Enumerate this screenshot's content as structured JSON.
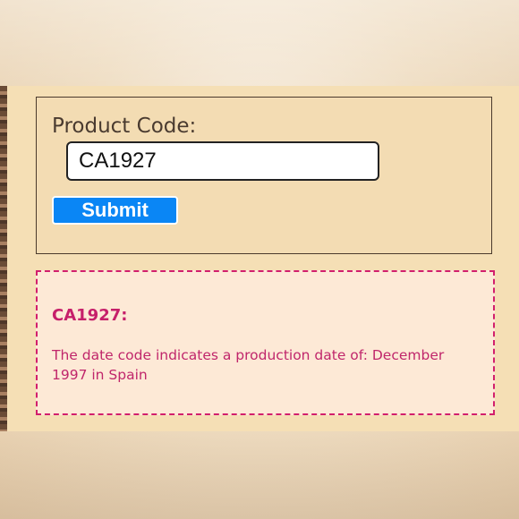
{
  "form": {
    "label": "Product Code:",
    "input_value": "CA1927",
    "submit_label": "Submit"
  },
  "result": {
    "code_heading": "CA1927:",
    "message": "The date code indicates a production date of: December 1997 in Spain"
  },
  "colors": {
    "panel_bg": "#f5dfb5",
    "button_blue": "#0a86f5",
    "result_accent": "#d21f6d",
    "result_bg": "#fde9d6"
  }
}
